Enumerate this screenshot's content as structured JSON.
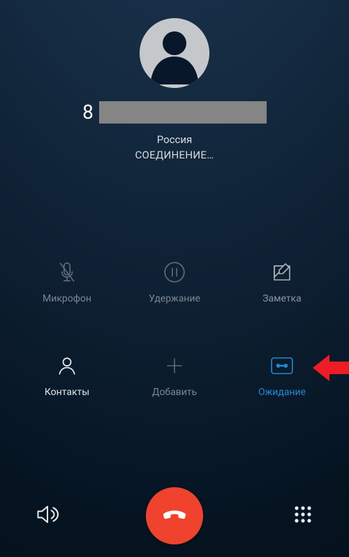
{
  "call": {
    "number_prefix": "8",
    "country": "Россия",
    "status": "СОЕДИНЕНИЕ…"
  },
  "controls": {
    "mute": {
      "label": "Микрофон"
    },
    "hold": {
      "label": "Удержание"
    },
    "note": {
      "label": "Заметка"
    },
    "contacts": {
      "label": "Контакты"
    },
    "add": {
      "label": "Добавить"
    },
    "waiting": {
      "label": "Ожидание"
    }
  }
}
